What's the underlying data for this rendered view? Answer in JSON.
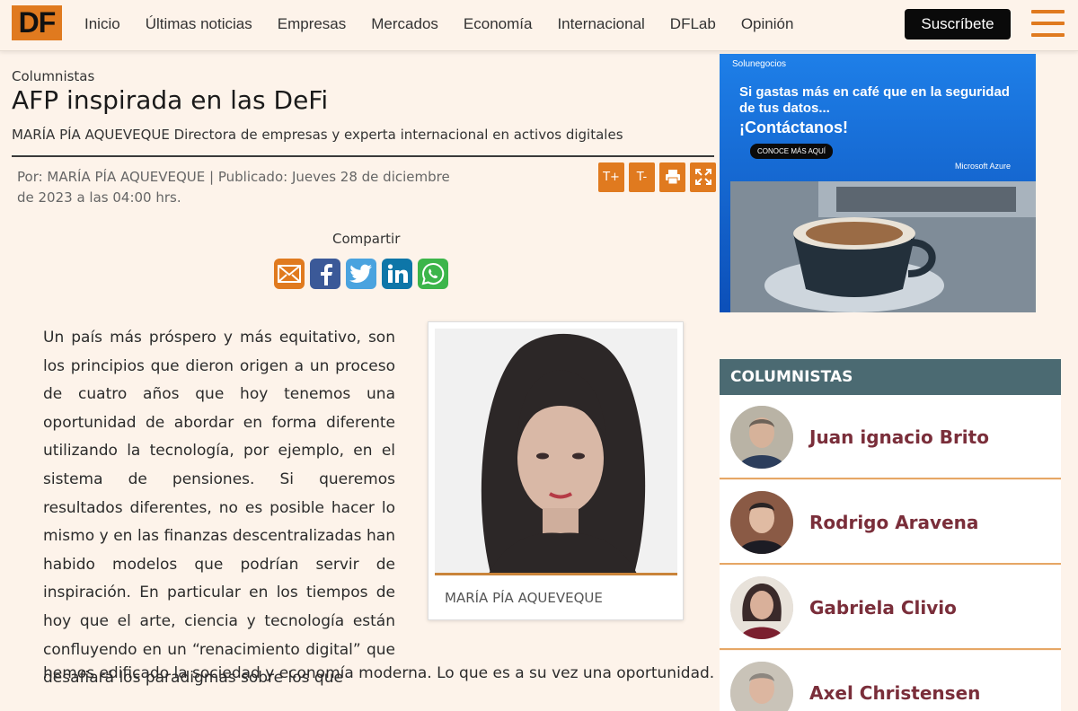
{
  "header": {
    "logo": "DF",
    "nav": [
      "Inicio",
      "Últimas noticias",
      "Empresas",
      "Mercados",
      "Economía",
      "Internacional",
      "DFLab",
      "Opinión"
    ],
    "subscribe_label": "Suscríbete"
  },
  "article": {
    "section": "Columnistas",
    "title": "AFP inspirada en las DeFi",
    "author_line": "MARÍA PÍA AQUEVEQUE Directora de empresas y experta internacional en activos digitales",
    "byline": "Por: MARÍA PÍA AQUEVEQUE | Publicado: Jueves 28 de diciembre de 2023 a las 04:00 hrs.",
    "tools": {
      "font_up": "T+",
      "font_down": "T-"
    },
    "share_label": "Compartir",
    "share_icons": [
      "email-icon",
      "facebook-icon",
      "twitter-icon",
      "linkedin-icon",
      "whatsapp-icon"
    ],
    "body_justified": "Un país más próspero y más equitativo, son los principios que dieron origen a un proceso de cuatro años que hoy tenemos una oportunidad de abordar en forma diferente utilizando la tecnología, por ejemplo, en el sistema de pensiones. Si queremos resultados diferentes, no es posible hacer lo mismo y en las finanzas descentralizadas han habido modelos que podrían servir de inspiración. En particular en los tiempos de hoy que el arte, ciencia y tecnología están confluyendo en un “renacimiento digital” que desafiará los paradigmas sobre los que",
    "body_last": "hemos edificado la sociedad y economía moderna. Lo que es a su vez una oportunidad.",
    "photo_caption": "MARÍA PÍA AQUEVEQUE"
  },
  "ad": {
    "brand": "Solunegocios",
    "headline": "Si gastas más en café que en la seguridad de tus datos...",
    "cta_text": "¡Contáctanos!",
    "button": "CONOCE MÁS AQUÍ",
    "partner": "Microsoft Azure"
  },
  "columnists": {
    "heading": "COLUMNISTAS",
    "items": [
      {
        "name": "Juan ignacio Brito"
      },
      {
        "name": "Rodrigo Aravena"
      },
      {
        "name": "Gabriela Clivio"
      },
      {
        "name": "Axel Christensen"
      }
    ]
  },
  "colors": {
    "accent": "#e07a1f",
    "panel_head": "#4b6a72",
    "columnist_name": "#7a2e3a",
    "background": "#fdf3ea"
  }
}
